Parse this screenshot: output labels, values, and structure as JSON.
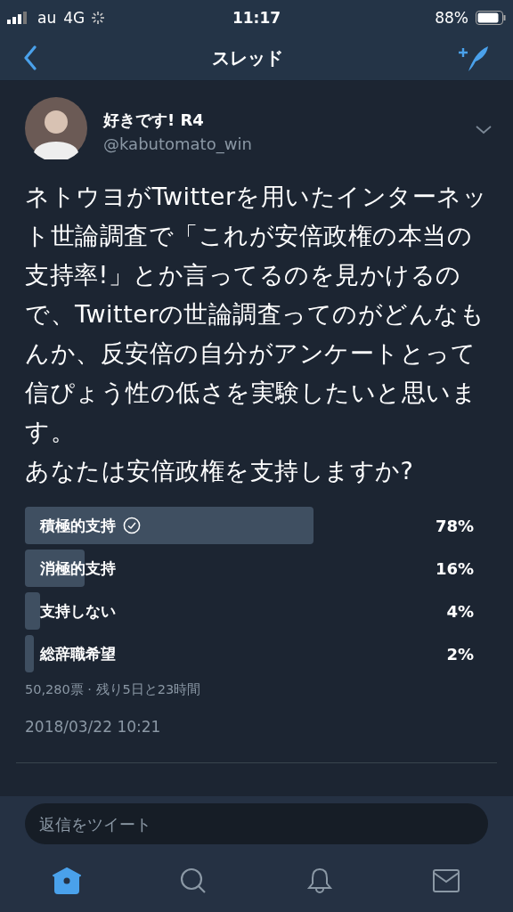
{
  "status_bar": {
    "carrier": "au",
    "network": "4G",
    "time": "11:17",
    "battery": "88%"
  },
  "nav": {
    "title": "スレッド"
  },
  "tweet": {
    "display_name": "好きです! R4",
    "handle": "@kabutomato_win",
    "text": "ネトウヨがTwitterを用いたインターネット世論調査で「これが安倍政権の本当の支持率!」とか言ってるのを見かけるので、Twitterの世論調査ってのがどんなもんか、反安倍の自分がアンケートとって信ぴょう性の低さを実験したいと思います。",
    "question": "あなたは安倍政権を支持しますか?",
    "poll": {
      "options": [
        {
          "label": "積極的支持",
          "percent": "78%",
          "selected": true
        },
        {
          "label": "消極的支持",
          "percent": "16%",
          "selected": false
        },
        {
          "label": "支持しない",
          "percent": "4%",
          "selected": false
        },
        {
          "label": "総辞職希望",
          "percent": "2%",
          "selected": false
        }
      ],
      "summary": "50,280票 · 残り5日と23時間"
    },
    "timestamp": "2018/03/22 10:21"
  },
  "reply": {
    "placeholder": "返信をツイート"
  },
  "tab_bar": [
    {
      "kind": "home",
      "selected": true
    },
    {
      "kind": "search",
      "selected": false
    },
    {
      "kind": "notifications",
      "selected": false
    },
    {
      "kind": "messages",
      "selected": false
    }
  ]
}
